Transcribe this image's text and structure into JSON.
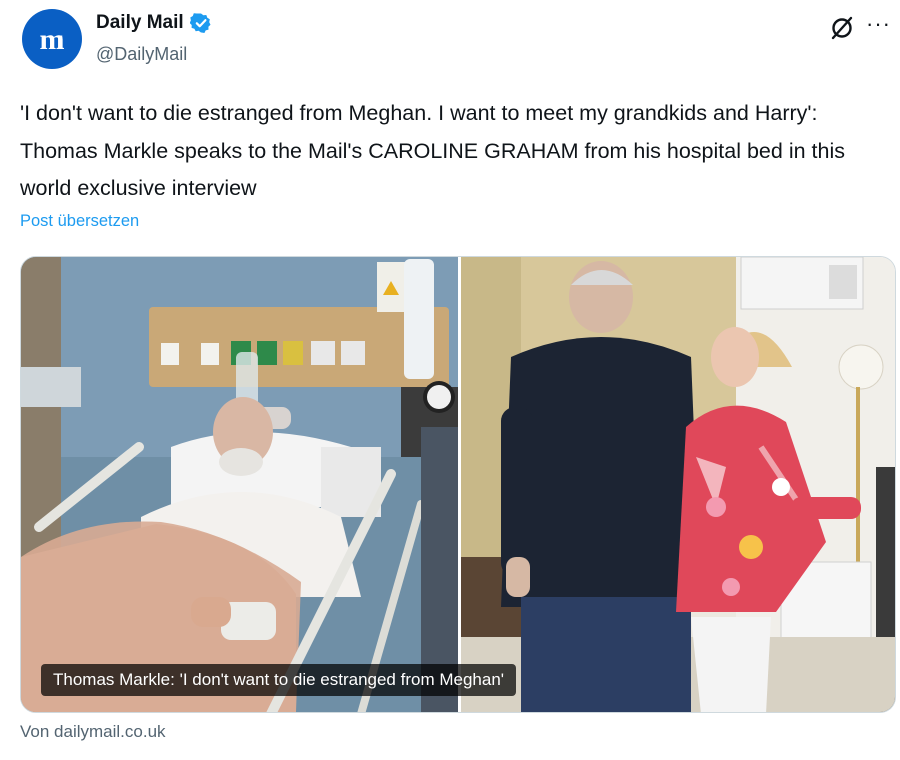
{
  "author": {
    "display_name": "Daily Mail",
    "handle": "@DailyMail",
    "avatar_icon": "daily-mail-logo",
    "verified": true,
    "brand_color": "#0a5fc4"
  },
  "tweet": {
    "text": "'I don't want to die estranged from Meghan. I want to meet my grandkids and Harry': Thomas Markle speaks to the Mail's CAROLINE GRAHAM from his hospital bed in this world exclusive interview",
    "translate_label": "Post übersetzen"
  },
  "media": {
    "caption": "Thomas Markle: 'I don't want to die estranged from Meghan'",
    "left_photo": "hospital-bed-photo",
    "right_photo": "two-people-standing-photo"
  },
  "card": {
    "source": "Von dailymail.co.uk"
  },
  "icons": {
    "grok": "grok-icon",
    "more": "more-icon",
    "verified": "verified-badge-icon"
  },
  "colors": {
    "link": "#1d9bf0",
    "secondary_text": "#536471"
  }
}
